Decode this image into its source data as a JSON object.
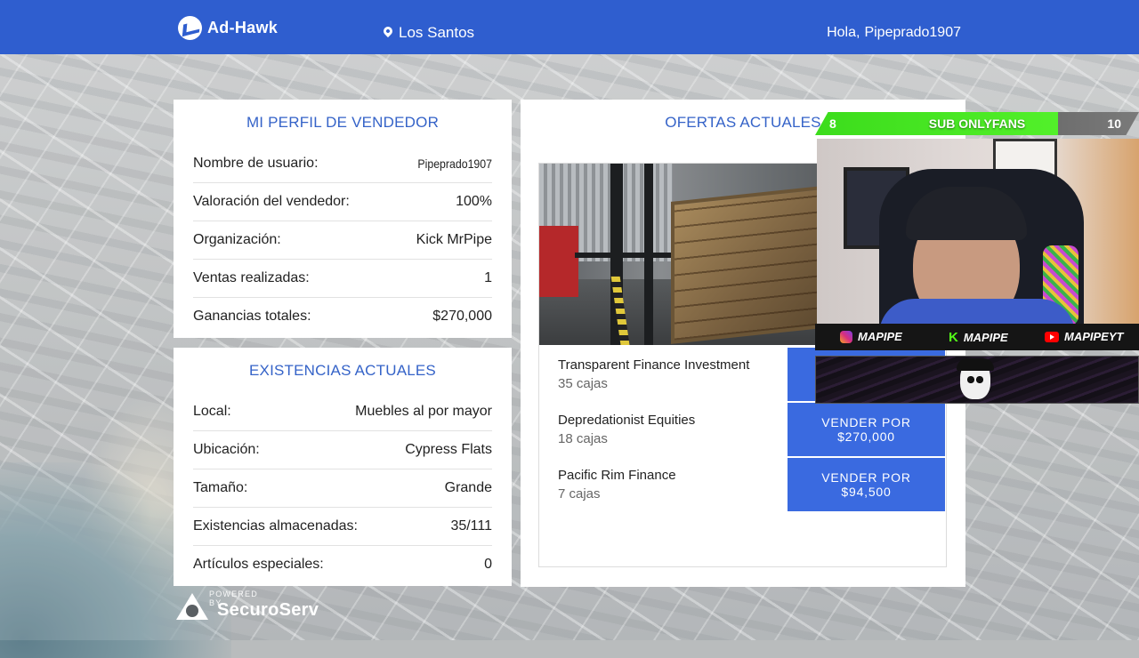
{
  "header": {
    "app_name": "Ad-Hawk",
    "location": "Los Santos",
    "greeting": "Hola,",
    "username": "Pipeprado1907"
  },
  "profile": {
    "title": "MI PERFIL DE VENDEDOR",
    "rows": [
      {
        "label": "Nombre de usuario:",
        "value": "Pipeprado1907"
      },
      {
        "label": "Valoración del vendedor:",
        "value": "100%"
      },
      {
        "label": "Organización:",
        "value": "Kick MrPipe"
      },
      {
        "label": "Ventas realizadas:",
        "value": "1"
      },
      {
        "label": "Ganancias totales:",
        "value": "$270,000"
      }
    ]
  },
  "stock": {
    "title": "EXISTENCIAS ACTUALES",
    "rows": [
      {
        "label": "Local:",
        "value": "Muebles al por mayor"
      },
      {
        "label": "Ubicación:",
        "value": "Cypress Flats"
      },
      {
        "label": "Tamaño:",
        "value": "Grande"
      },
      {
        "label": "Existencias almacenadas:",
        "value": "35/111"
      },
      {
        "label": "Artículos especiales:",
        "value": "0"
      }
    ]
  },
  "offers": {
    "title": "OFERTAS ACTUALES",
    "items": [
      {
        "buyer": "Transparent Finance Investment",
        "qty": "35 cajas",
        "button_top": "",
        "button_price": ""
      },
      {
        "buyer": "Depredationist Equities",
        "qty": "18 cajas",
        "button_top": "VENDER POR",
        "button_price": "$270,000"
      },
      {
        "buyer": "Pacific Rim Finance",
        "qty": "7 cajas",
        "button_top": "VENDER POR",
        "button_price": "$94,500"
      }
    ]
  },
  "footer": {
    "powered_small": "POWERED BY",
    "powered_brand": "SecuroServ"
  },
  "stream_overlay": {
    "sub_left": "8",
    "sub_label": "SUB ONLYFANS",
    "sub_right": "10",
    "instagram": "MAPIPE",
    "kick": "MAPIPE",
    "youtube": "MAPIPEYT"
  },
  "colors": {
    "header_blue": "#2f5ecf",
    "title_blue": "#3563c8",
    "button_blue": "#3a6ae0",
    "sub_green": "#52f02a"
  }
}
